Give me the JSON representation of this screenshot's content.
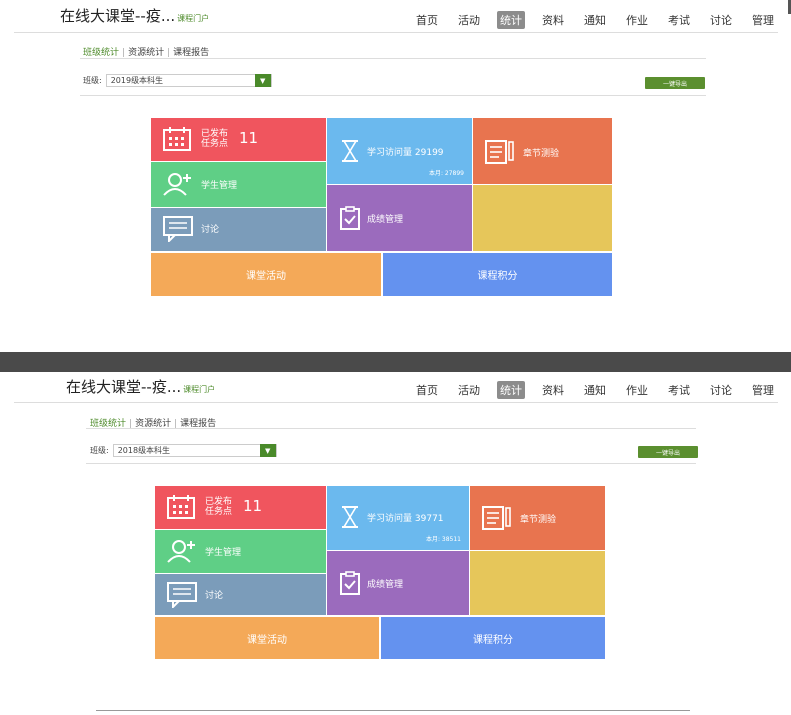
{
  "panels": [
    {
      "brand": "在线大课堂--疫...",
      "brand_sub": "课程门户",
      "nav": [
        "首页",
        "活动",
        "统计",
        "资料",
        "通知",
        "作业",
        "考试",
        "讨论",
        "管理"
      ],
      "active_nav_index": 2,
      "subtabs": [
        "班级统计",
        "资源统计",
        "课程报告"
      ],
      "class_label": "班级:",
      "class_value": "2019级本科生",
      "export_label": "一键导出",
      "tiles": {
        "published_line1": "已发布",
        "published_line2": "任务点",
        "published_count": "11",
        "visits_label": "学习访问量",
        "visits_count": "29199",
        "monthly_label": "本月:",
        "monthly_count": "27899",
        "quiz_label": "章节测验",
        "students_label": "学生管理",
        "grades_label": "成绩管理",
        "discussion_label": "讨论",
        "activity_label": "课堂活动",
        "points_label": "课程积分"
      }
    },
    {
      "brand": "在线大课堂--疫...",
      "brand_sub": "课程门户",
      "nav": [
        "首页",
        "活动",
        "统计",
        "资料",
        "通知",
        "作业",
        "考试",
        "讨论",
        "管理"
      ],
      "active_nav_index": 2,
      "subtabs": [
        "班级统计",
        "资源统计",
        "课程报告"
      ],
      "class_label": "班级:",
      "class_value": "2018级本科生",
      "export_label": "一键导出",
      "tiles": {
        "published_line1": "已发布",
        "published_line2": "任务点",
        "published_count": "11",
        "visits_label": "学习访问量",
        "visits_count": "39771",
        "monthly_label": "本月:",
        "monthly_count": "38511",
        "quiz_label": "章节测验",
        "students_label": "学生管理",
        "grades_label": "成绩管理",
        "discussion_label": "讨论",
        "activity_label": "课堂活动",
        "points_label": "课程积分"
      }
    }
  ],
  "colors": {
    "red": "#f0555e",
    "sky_blue": "#6bb9ee",
    "coral": "#e8744f",
    "green": "#5fcf86",
    "purple": "#9b6bbd",
    "yellow": "#e6c65a",
    "steel_blue": "#7b9cba",
    "orange": "#f4a958",
    "blue": "#6492ef",
    "accent_green": "#5b8f2f"
  },
  "icons": [
    "calendar-icon",
    "hourglass-icon",
    "document-pen-icon",
    "user-add-icon",
    "clipboard-check-icon",
    "chat-icon",
    "chevron-down-icon"
  ]
}
